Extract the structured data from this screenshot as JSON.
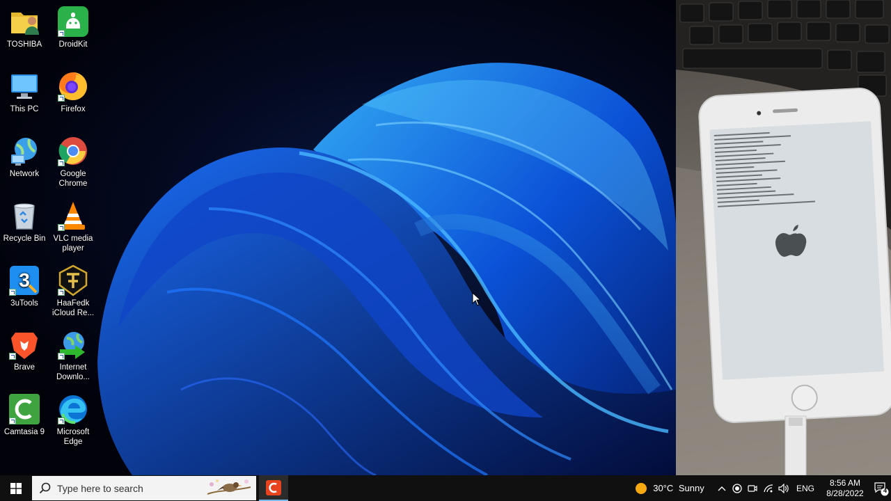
{
  "desktop": {
    "icons": [
      {
        "label": "TOSHIBA",
        "icon": "user-folder-icon"
      },
      {
        "label": "DroidKit",
        "icon": "droidkit-icon"
      },
      {
        "label": "This PC",
        "icon": "this-pc-icon"
      },
      {
        "label": "Firefox",
        "icon": "firefox-icon"
      },
      {
        "label": "Network",
        "icon": "network-icon"
      },
      {
        "label": "Google Chrome",
        "icon": "chrome-icon"
      },
      {
        "label": "Recycle Bin",
        "icon": "recycle-bin-icon"
      },
      {
        "label": "VLC media player",
        "icon": "vlc-icon"
      },
      {
        "label": "3uTools",
        "icon": "3utools-icon"
      },
      {
        "label": "HaaFedk iCloud Re...",
        "icon": "haafedk-icon"
      },
      {
        "label": "Brave",
        "icon": "brave-icon"
      },
      {
        "label": "Internet Downlo...",
        "icon": "idm-icon"
      },
      {
        "label": "Camtasia 9",
        "icon": "camtasia-icon"
      },
      {
        "label": "Microsoft Edge",
        "icon": "edge-icon"
      }
    ]
  },
  "taskbar": {
    "search_placeholder": "Type here to search",
    "weather": {
      "temp": "30°C",
      "condition": "Sunny"
    },
    "language": "ENG",
    "time": "8:56 AM",
    "date": "8/28/2022",
    "notification_count": "4"
  },
  "colors": {
    "taskbar_bg": "#101010",
    "accent": "#76b9ed",
    "wallpaper_blue": "#1e6cf0"
  }
}
